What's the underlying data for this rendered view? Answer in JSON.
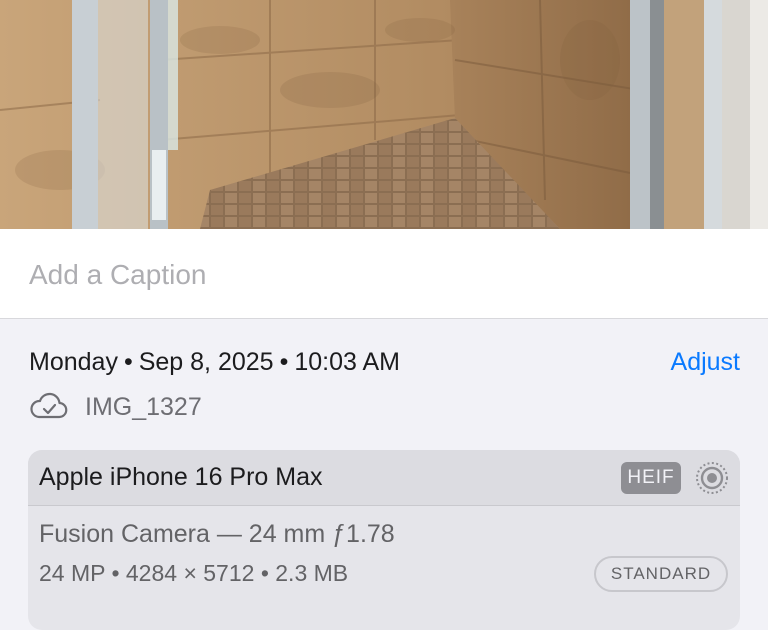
{
  "caption": {
    "placeholder": "Add a Caption"
  },
  "metadata": {
    "day": "Monday",
    "date": "Sep 8, 2025",
    "time": "10:03 AM",
    "separator": "•",
    "adjust_label": "Adjust",
    "file_name": "IMG_1327",
    "sync_icon": "cloud-check-icon"
  },
  "camera": {
    "device": "Apple iPhone 16 Pro Max",
    "format_badge": "HEIF",
    "live_icon": "live-photo-icon",
    "lens": "Fusion Camera — 24 mm ƒ1.78",
    "specs": "24 MP • 4284 × 5712 • 2.3 MB",
    "mode_badge": "STANDARD"
  },
  "colors": {
    "accent": "#0a7aff",
    "background": "#f2f2f7",
    "card": "#e5e5ea"
  }
}
